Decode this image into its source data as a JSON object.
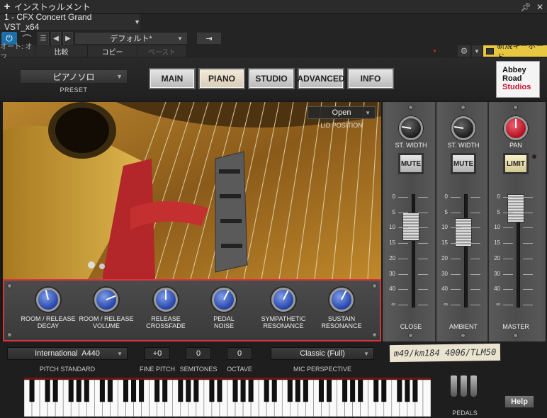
{
  "window": {
    "title": "インストゥルメント"
  },
  "host": {
    "slot_name": "1 - CFX Concert Grand VST_x64",
    "preset_name": "デフォルト*",
    "auto_label": "オート: オフ",
    "compare_label": "比較",
    "copy_label": "コピー",
    "paste_label": "ペースト",
    "keyboard_label": "新規キーボード"
  },
  "header": {
    "preset_value": "ピアノソロ",
    "preset_label": "PRESET",
    "tabs": [
      {
        "label": "MAIN"
      },
      {
        "label": "PIANO"
      },
      {
        "label": "STUDIO"
      },
      {
        "label": "ADVANCED"
      },
      {
        "label": "INFO"
      }
    ],
    "logo_line1": "Abbey",
    "logo_line2": "Road",
    "logo_line3": "Studios"
  },
  "lid": {
    "value": "Open",
    "label": "LID POSITION"
  },
  "knobs": [
    {
      "line1": "ROOM / RELEASE",
      "line2": "DECAY",
      "value": 0.45
    },
    {
      "line1": "ROOM / RELEASE",
      "line2": "VOLUME",
      "value": 0.75
    },
    {
      "line1": "RELEASE",
      "line2": "CROSSFADE",
      "value": 0.5
    },
    {
      "line1": "PEDAL",
      "line2": "NOISE",
      "value": 0.6
    },
    {
      "line1": "SYMPATHETIC",
      "line2": "RESONANCE",
      "value": 0.6
    },
    {
      "line1": "SUSTAIN",
      "line2": "RESONANCE",
      "value": 0.6
    }
  ],
  "bottom": {
    "pitch_standard": {
      "value": "International  A440",
      "label": "PITCH STANDARD"
    },
    "fine_pitch": {
      "value": "+0",
      "label": "FINE PITCH"
    },
    "semitones": {
      "value": "0",
      "label": "SEMITONES"
    },
    "octave": {
      "value": "0",
      "label": "OCTAVE"
    },
    "mic_perspective": {
      "value": "Classic (Full)",
      "label": "MIC PERSPECTIVE"
    },
    "pedals_label": "PEDALS",
    "help_label": "Help"
  },
  "mixer": {
    "tape_text": "m49/km184 4006/TLM50",
    "scale": [
      "0",
      "5",
      "10",
      "15",
      "20",
      "30",
      "40",
      "∞"
    ],
    "strips": [
      {
        "name": "CLOSE",
        "knob_label": "ST. WIDTH",
        "button": "MUTE",
        "fader_level": 0.78,
        "knob_value": 0.2
      },
      {
        "name": "AMBIENT",
        "knob_label": "ST. WIDTH",
        "button": "MUTE",
        "fader_level": 0.72,
        "knob_value": 0.2
      },
      {
        "name": "MASTER",
        "knob_label": "PAN",
        "button": "LIMIT",
        "fader_level": 1.0,
        "knob_value": 0.5
      }
    ]
  }
}
